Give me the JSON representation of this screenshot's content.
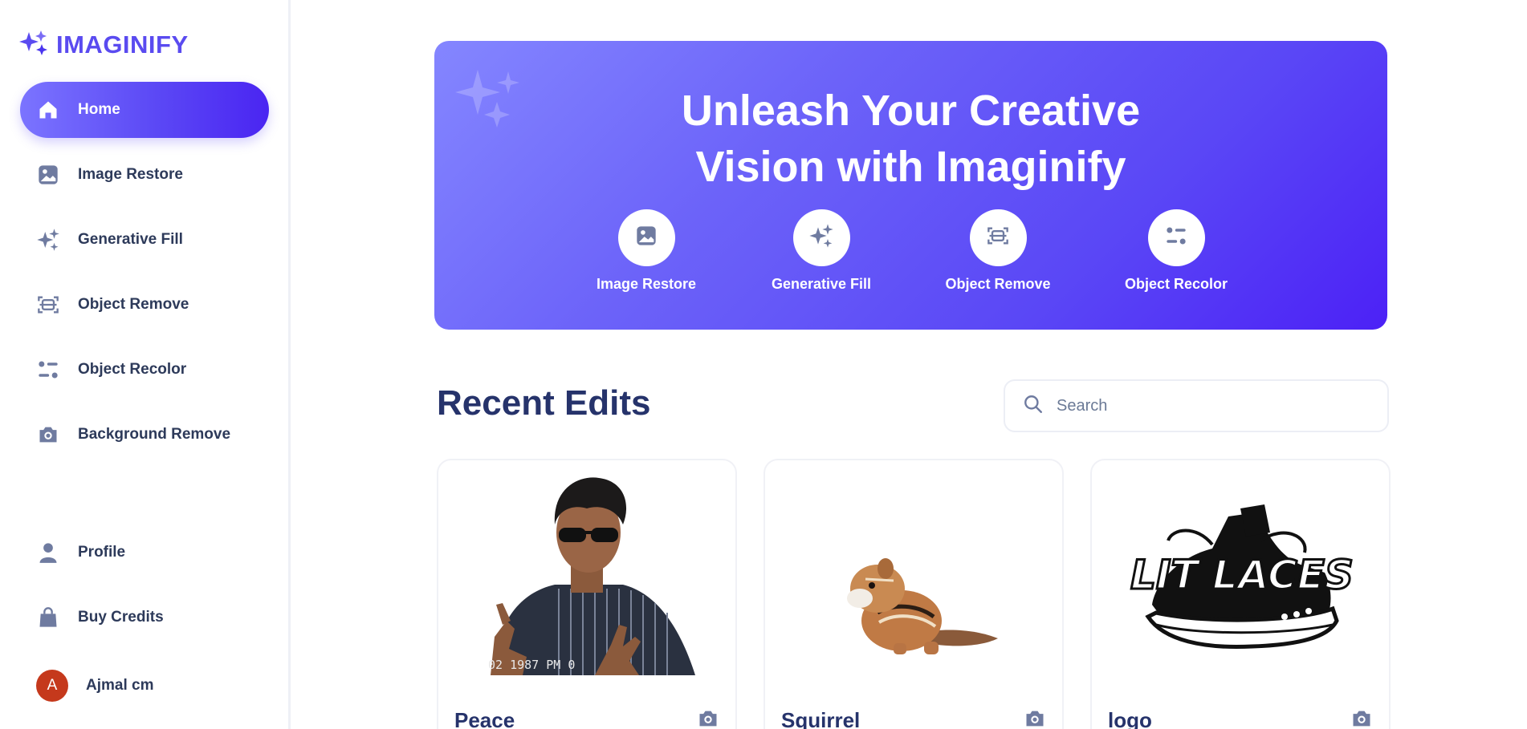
{
  "app": {
    "name": "IMAGINIFY",
    "accent": "#5a4bf0"
  },
  "sidebar": {
    "items": [
      {
        "label": "Home",
        "icon": "home-icon",
        "active": true
      },
      {
        "label": "Image Restore",
        "icon": "image-icon"
      },
      {
        "label": "Generative Fill",
        "icon": "stars-icon"
      },
      {
        "label": "Object Remove",
        "icon": "scan-icon"
      },
      {
        "label": "Object Recolor",
        "icon": "filter-icon"
      },
      {
        "label": "Background Remove",
        "icon": "camera-icon"
      }
    ],
    "bottom": [
      {
        "label": "Profile",
        "icon": "user-icon"
      },
      {
        "label": "Buy Credits",
        "icon": "bag-icon"
      }
    ],
    "user": {
      "name": "Ajmal cm",
      "initial": "A",
      "color": "#c5391c"
    }
  },
  "banner": {
    "title_line1": "Unleash Your Creative",
    "title_line2": "Vision with Imaginify",
    "tools": [
      {
        "label": "Image Restore",
        "icon": "image-icon"
      },
      {
        "label": "Generative Fill",
        "icon": "stars-icon"
      },
      {
        "label": "Object Remove",
        "icon": "scan-icon"
      },
      {
        "label": "Object Recolor",
        "icon": "filter-icon"
      }
    ]
  },
  "recent": {
    "title": "Recent Edits",
    "search_placeholder": "Search",
    "cards": [
      {
        "title": "Peace",
        "icon": "camera-icon",
        "image_text": "02 1987        PM 0"
      },
      {
        "title": "Squirrel",
        "icon": "camera-icon"
      },
      {
        "title": "logo",
        "icon": "camera-icon",
        "image_text": "LIT LACES"
      }
    ]
  }
}
